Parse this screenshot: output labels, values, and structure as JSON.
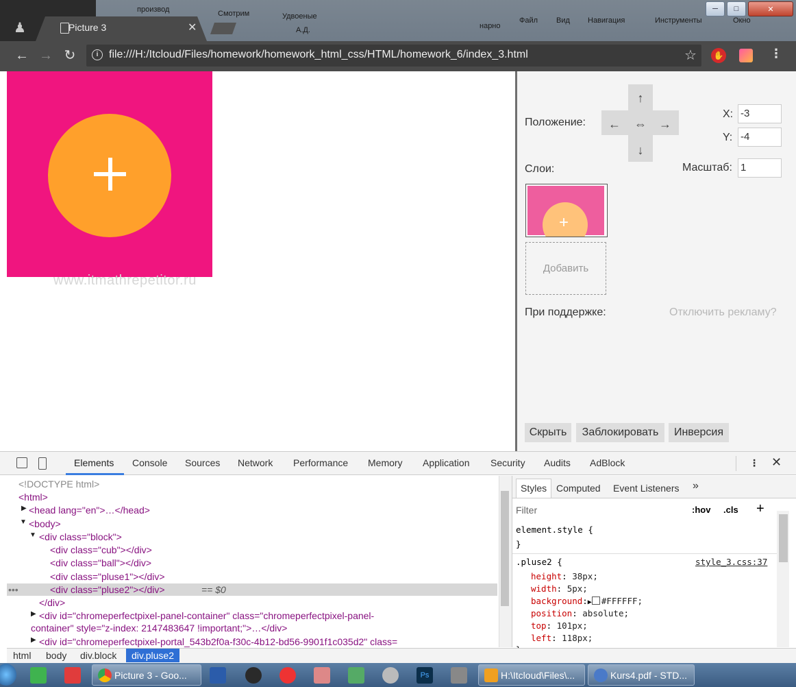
{
  "browser": {
    "tab_title": "Picture 3",
    "url": "file:///H:/Itcloud/Files/homework/homework_html_css/HTML/homework_6/index_3.html"
  },
  "background_window_text": [
    "производ",
    "Смотрим",
    "Удвоеные",
    "Файл",
    "Вид",
    "Навигация",
    "Инструменты",
    "Окно",
    "А.Д.",
    "нарно"
  ],
  "page": {
    "watermark": "www.itmathrepetitor.ru",
    "colors": {
      "cub": "#f0157f",
      "ball": "#ffa02b",
      "plus": "#FFFFFF"
    }
  },
  "pixel_perfect": {
    "position_label": "Положение:",
    "arrows": {
      "up": "↑",
      "down": "↓",
      "left": "←",
      "right": "→",
      "center": "⇔"
    },
    "x_label": "X:",
    "x_value": "-3",
    "y_label": "Y:",
    "y_value": "-4",
    "layers_label": "Слои:",
    "scale_label": "Масштаб:",
    "scale_value": "1",
    "add_label": "Добавить",
    "support_label": "При поддержке:",
    "disable_ads": "Отключить рекламу?",
    "buttons": {
      "hide": "Скрыть",
      "lock": "Заблокировать",
      "invert": "Инверсия"
    }
  },
  "devtools": {
    "tabs": [
      "Elements",
      "Console",
      "Sources",
      "Network",
      "Performance",
      "Memory",
      "Application",
      "Security",
      "Audits",
      "AdBlock"
    ],
    "active_tab": "Elements",
    "dom": {
      "doctype": "<!DOCTYPE html>",
      "html": "<html>",
      "head": "<head lang=\"en\">…</head>",
      "body": "<body>",
      "block_open": "<div class=\"block\">",
      "cub": "<div class=\"cub\"></div>",
      "ball": "<div class=\"ball\"></div>",
      "pluse1": "<div class=\"pluse1\"></div>",
      "pluse2": "<div class=\"pluse2\"></div>",
      "selected_marker": "== $0",
      "ellipsis": "•••",
      "block_close": "</div>",
      "panel_line1": "<div id=\"chromeperfectpixel-panel-container\" class=\"chromeperfectpixel-panel-",
      "panel_line2": "container\" style=\"z-index: 2147483647 !important;\">…</div>",
      "portal_line": "<div id=\"chromeperfectpixel-portal_543b2f0a-f30c-4b12-bd56-9901f1c035d2\" class="
    },
    "styles_tabs": [
      "Styles",
      "Computed",
      "Event Listeners"
    ],
    "more_tabs": "»",
    "filter_placeholder": "Filter",
    "hov": ":hov",
    "cls": ".cls",
    "plus": "+",
    "element_style_open": "element.style {",
    "element_style_close": "}",
    "rule_selector": ".pluse2 {",
    "rule_source": "style_3.css:37",
    "rule_close": "}",
    "rule_props": [
      {
        "name": "height",
        "value": "38px;"
      },
      {
        "name": "width",
        "value": "5px;"
      },
      {
        "name": "background",
        "value": "#FFFFFF;"
      },
      {
        "name": "position",
        "value": "absolute;"
      },
      {
        "name": "top",
        "value": "101px;"
      },
      {
        "name": "left",
        "value": "118px;"
      }
    ],
    "breadcrumbs": [
      "html",
      "body",
      "div.block",
      "div.pluse2"
    ]
  },
  "taskbar": {
    "chrome_task": "Picture 3 - Goo...",
    "explorer_task": "H:\\Itcloud\\Files\\...",
    "pdf_task": "Kurs4.pdf - STD..."
  }
}
